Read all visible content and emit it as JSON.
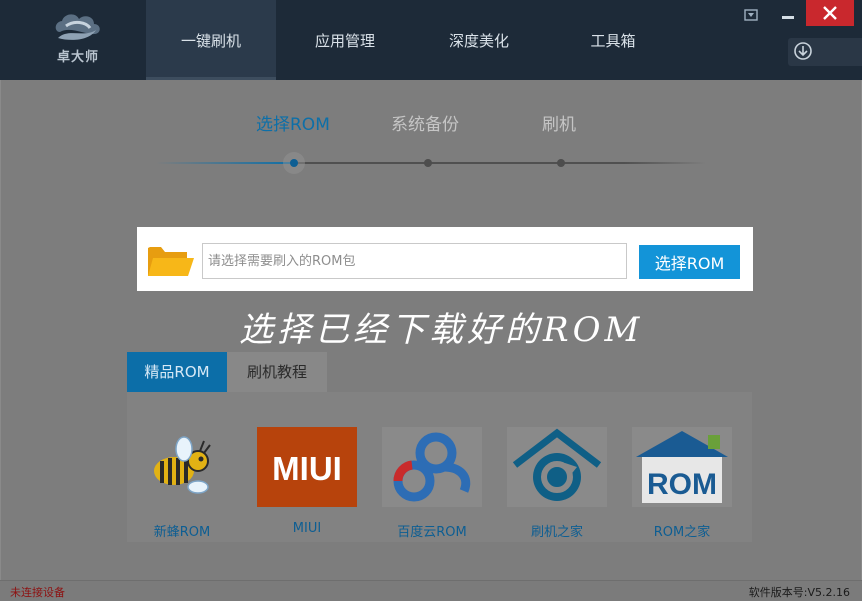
{
  "app": {
    "logo_text": "卓大师"
  },
  "nav": {
    "tabs": [
      {
        "label": "一键刷机",
        "active": true
      },
      {
        "label": "应用管理",
        "active": false
      },
      {
        "label": "深度美化",
        "active": false
      },
      {
        "label": "工具箱",
        "active": false
      }
    ]
  },
  "steps": [
    {
      "label": "选择ROM",
      "active": true
    },
    {
      "label": "系统备份",
      "active": false
    },
    {
      "label": "刷机",
      "active": false
    }
  ],
  "rom_picker": {
    "placeholder": "请选择需要刷入的ROM包",
    "button_label": "选择ROM"
  },
  "caption": "选择已经下载好的ROM",
  "sub_tabs": [
    {
      "label": "精品ROM",
      "active": true
    },
    {
      "label": "刷机教程",
      "active": false
    }
  ],
  "apps": [
    {
      "label": "新蜂ROM",
      "icon": "bee-icon"
    },
    {
      "label": "MIUI",
      "icon": "miui-logo-icon"
    },
    {
      "label": "百度云ROM",
      "icon": "baidu-cloud-icon"
    },
    {
      "label": "刷机之家",
      "icon": "refresh-house-icon"
    },
    {
      "label": "ROM之家",
      "icon": "rom-house-icon"
    }
  ],
  "miui_logo_text": "MIUI",
  "rom_logo_text": "ROM",
  "status": {
    "connection": "未连接设备",
    "version": "软件版本号:V5.2.16"
  },
  "colors": {
    "topbar": "#1d2a38",
    "accent": "#1394d8",
    "close": "#c9282d",
    "status_error": "#8d1111"
  }
}
